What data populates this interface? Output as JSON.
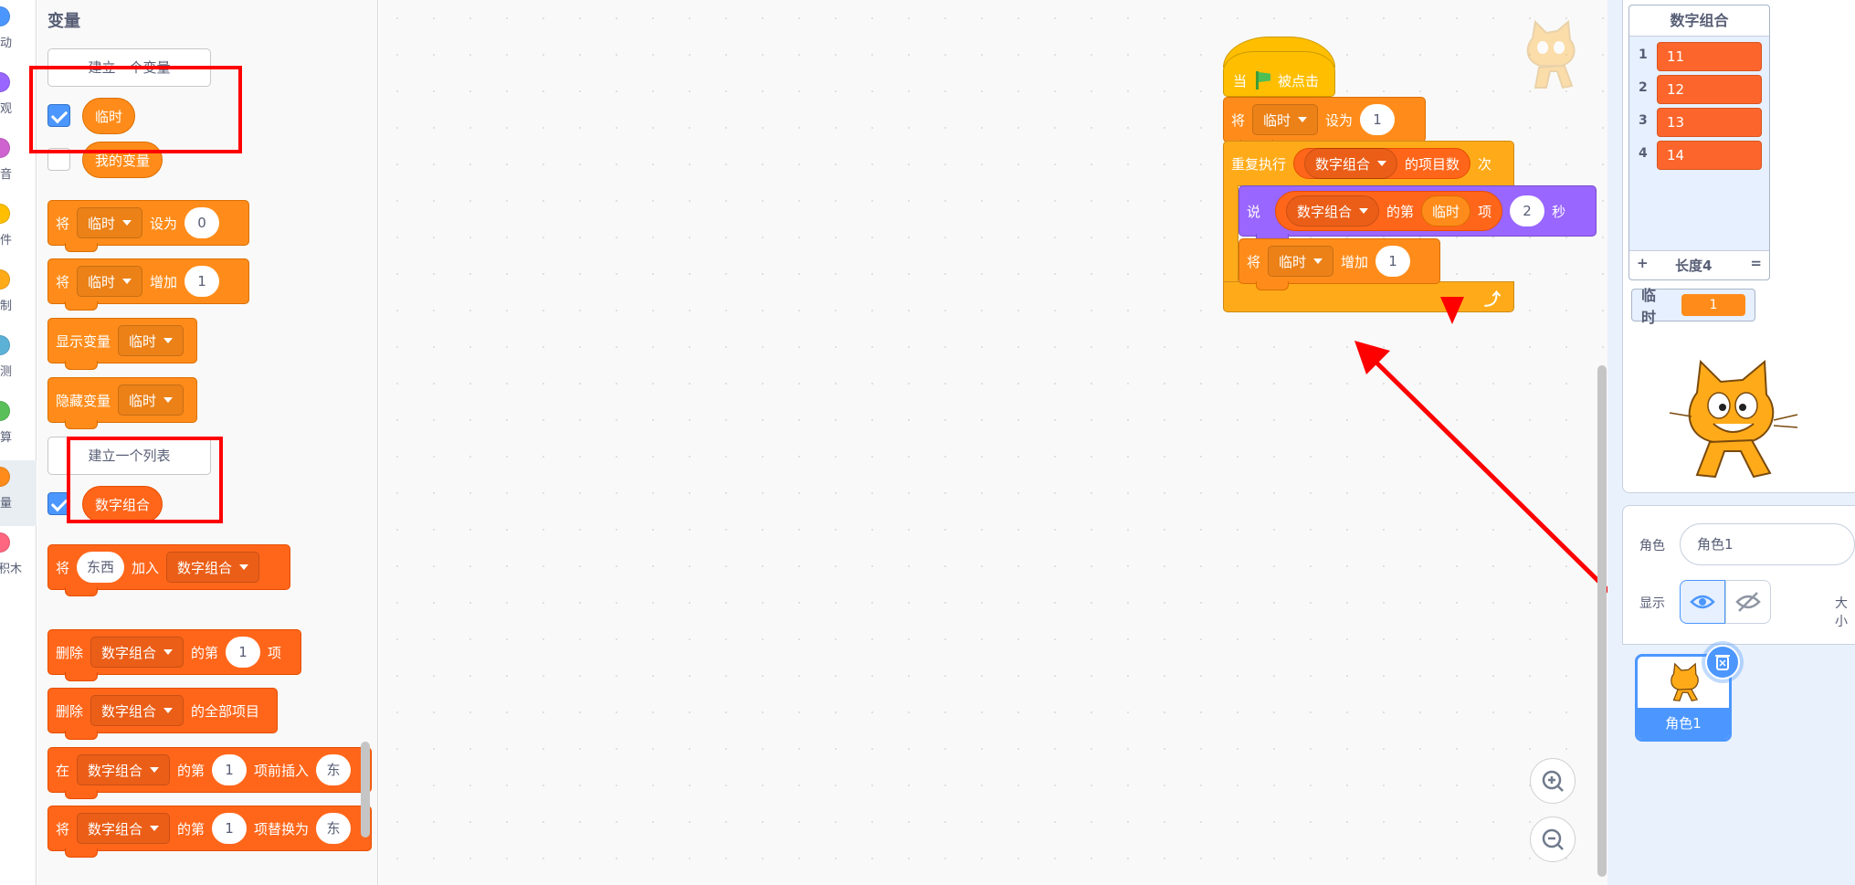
{
  "categories": [
    {
      "label": "动",
      "color": "#4c97ff"
    },
    {
      "label": "观",
      "color": "#9966ff"
    },
    {
      "label": "音",
      "color": "#cf63cf"
    },
    {
      "label": "件",
      "color": "#ffbf00"
    },
    {
      "label": "制",
      "color": "#ffab19"
    },
    {
      "label": "测",
      "color": "#5cb1d6"
    },
    {
      "label": "算",
      "color": "#59c059"
    },
    {
      "label": "量",
      "color": "#ff8c1a"
    },
    {
      "label": "积木",
      "color": "#ff6680"
    }
  ],
  "palette": {
    "title": "变量",
    "make_variable": "建立一个变量",
    "var_temp": "临时",
    "var_mine": "我的变量",
    "make_list": "建立一个列表",
    "list_name": "数字组合",
    "blocks": {
      "set_prefix": "将",
      "set_var": "临时",
      "set_word": "设为",
      "set_value": "0",
      "change_prefix": "将",
      "change_var": "临时",
      "change_word": "增加",
      "change_value": "1",
      "show_word": "显示变量",
      "show_var": "临时",
      "hide_word": "隐藏变量",
      "hide_var": "临时",
      "add_prefix": "将",
      "add_item": "东西",
      "add_word": "加入",
      "add_list": "数字组合",
      "del_prefix": "删除",
      "del_list": "数字组合",
      "del_of": "的第",
      "del_idx": "1",
      "del_suffix": "项",
      "delall_prefix": "删除",
      "delall_list": "数字组合",
      "delall_suffix": "的全部项目",
      "ins_prefix": "在",
      "ins_list": "数字组合",
      "ins_of": "的第",
      "ins_idx": "1",
      "ins_suffix": "项前插入",
      "ins_val": "东",
      "rep_prefix": "将",
      "rep_list": "数字组合",
      "rep_of": "的第",
      "rep_idx": "1",
      "rep_suffix": "项替换为",
      "rep_val": "东"
    }
  },
  "script": {
    "hat_when": "当",
    "hat_clicked": "被点击",
    "set_prefix": "将",
    "set_var": "临时",
    "set_word": "设为",
    "set_value": "1",
    "repeat_word": "重复执行",
    "repeat_list": "数字组合",
    "repeat_length": "的项目数",
    "repeat_times": "次",
    "say_word": "说",
    "say_list": "数字组合",
    "say_of": "的第",
    "say_var": "临时",
    "say_item": "项",
    "say_secs": "2",
    "say_sec_word": "秒",
    "change_prefix": "将",
    "change_var": "临时",
    "change_word": "增加",
    "change_value": "1"
  },
  "stage": {
    "list_monitor": {
      "title": "数字组合",
      "items": [
        {
          "index": "1",
          "value": "11"
        },
        {
          "index": "2",
          "value": "12"
        },
        {
          "index": "3",
          "value": "13"
        },
        {
          "index": "4",
          "value": "14"
        }
      ],
      "add": "+",
      "length": "长度4",
      "resize": "="
    },
    "var_monitor": {
      "name": "临时",
      "value": "1"
    }
  },
  "sprite_info": {
    "sprite_label": "角色",
    "sprite_name": "角色1",
    "show_label": "显示",
    "size_label": "大小"
  },
  "sprites": [
    {
      "name": "角色1"
    }
  ],
  "colors": {
    "variables": "#ff8c1a",
    "lists": "#ff661a",
    "looks": "#9966ff",
    "control": "#ffab19",
    "events": "#ffbf00",
    "highlight": "#ff0000"
  }
}
